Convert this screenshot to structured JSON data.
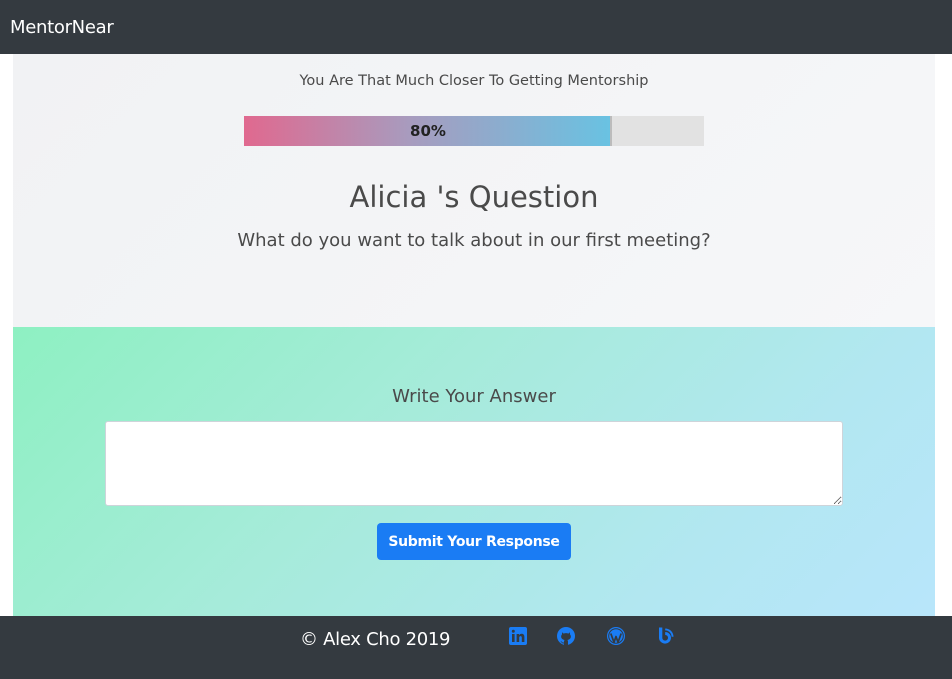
{
  "navbar": {
    "brand": "MentorNear"
  },
  "question_section": {
    "tagline": "You Are That Much Closer To Getting Mentorship",
    "progress": {
      "value": 80,
      "label": "80%"
    },
    "title": "Alicia 's Question",
    "question": "What do you want to talk about in our first meeting?"
  },
  "answer_section": {
    "label": "Write Your Answer",
    "answer_value": "",
    "submit_label": "Submit Your Response"
  },
  "footer": {
    "copyright": "© Alex Cho 2019",
    "social_links": [
      {
        "icon": "linkedin-icon"
      },
      {
        "icon": "github-icon"
      },
      {
        "icon": "wordpress-icon"
      },
      {
        "icon": "blog-icon"
      }
    ],
    "icon_color": "#1a7cf4"
  },
  "colors": {
    "navbar_bg": "#343a40",
    "primary": "#1a7cf4"
  }
}
